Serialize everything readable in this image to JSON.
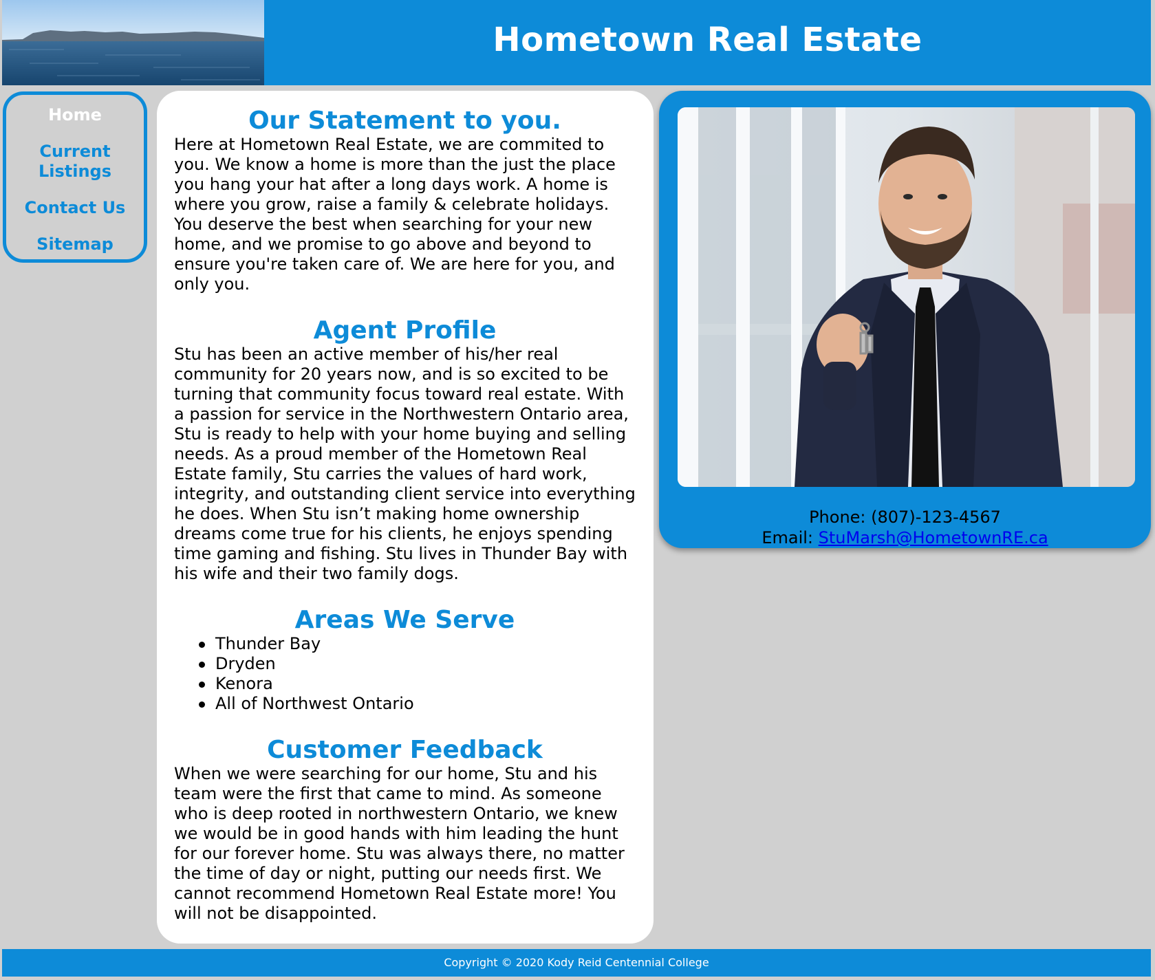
{
  "header": {
    "title": "Hometown Real Estate"
  },
  "nav": {
    "items": [
      {
        "label": "Home"
      },
      {
        "label": "Current Listings"
      },
      {
        "label": "Contact Us"
      },
      {
        "label": "Sitemap"
      }
    ]
  },
  "main": {
    "statement": {
      "heading": "Our Statement to you.",
      "body": "Here at Hometown Real Estate, we are commited to you. We know a home is more than the just the place you hang your hat after a long days work. A home is where you grow, raise a family & celebrate holidays. You deserve the best when searching for your new home, and we promise to go above and beyond to ensure you're taken care of. We are here for you, and only you."
    },
    "profile": {
      "heading": "Agent Profile",
      "body": "Stu has been an active member of his/her real community for 20 years now, and is so excited to be turning that community focus toward real estate. With a passion for service in the Northwestern Ontario area, Stu is ready to help with your home buying and selling needs. As a proud member of the Hometown Real Estate family, Stu carries the values of hard work, integrity, and outstanding client service into everything he does. When Stu isn’t making home ownership dreams come true for his clients, he enjoys spending time gaming and fishing. Stu lives in Thunder Bay with his wife and their two family dogs."
    },
    "areas": {
      "heading": "Areas We Serve",
      "items": [
        "Thunder Bay",
        "Dryden",
        "Kenora",
        "All of Northwest Ontario"
      ]
    },
    "feedback": {
      "heading": "Customer Feedback",
      "body": "When we were searching for our home, Stu and his team were the first that came to mind. As someone who is deep rooted in northwestern Ontario, we knew we would be in good hands with him leading the hunt for our forever home. Stu was always there, no matter the time of day or night, putting our needs first. We cannot recommend Hometown Real Estate more! You will not be disappointed."
    }
  },
  "contact": {
    "phone_label": "Phone:",
    "phone": "(807)-123-4567",
    "email_label": "Email:",
    "email": "StuMarsh@HometownRE.ca"
  },
  "footer": {
    "copyright": "Copyright © 2020 Kody Reid Centennial College"
  },
  "colors": {
    "brand_blue": "#0d8bd8",
    "page_bg": "#d0d0d0",
    "link": "#0000ee"
  },
  "icons": {
    "header_image": "lake-landscape-photo",
    "agent_image": "agent-holding-keys-photo"
  }
}
